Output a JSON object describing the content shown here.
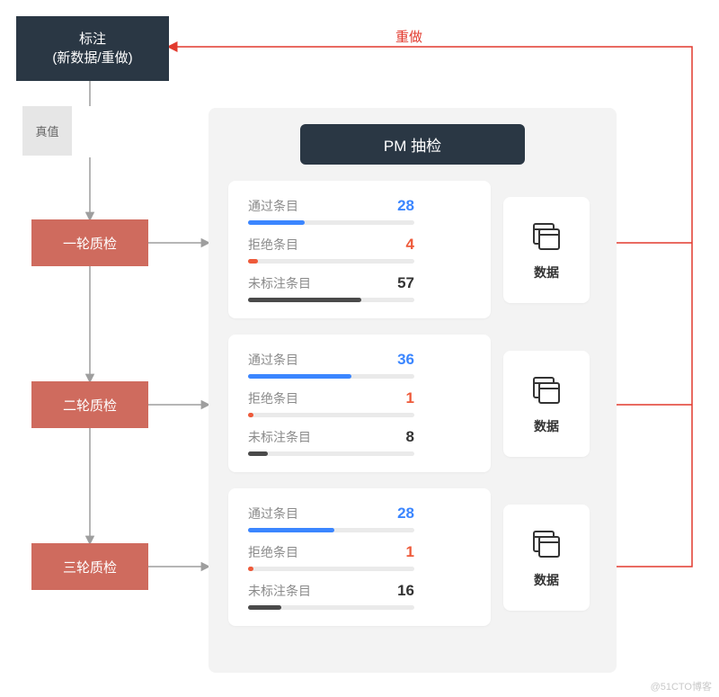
{
  "annotate": {
    "line1": "标注",
    "line2": "(新数据/重做)"
  },
  "truth_label": "真值",
  "rounds": [
    "一轮质检",
    "二轮质检",
    "三轮质检"
  ],
  "panel_title": "PM 抽检",
  "metric_labels": {
    "pass": "通过条目",
    "reject": "拒绝条目",
    "unlabeled": "未标注条目"
  },
  "cards": [
    {
      "pass": 28,
      "reject": 4,
      "unlabeled": 57,
      "pass_w": 34,
      "reject_w": 6,
      "unlabeled_w": 68
    },
    {
      "pass": 36,
      "reject": 1,
      "unlabeled": 8,
      "pass_w": 62,
      "reject_w": 3,
      "unlabeled_w": 12
    },
    {
      "pass": 28,
      "reject": 1,
      "unlabeled": 16,
      "pass_w": 52,
      "reject_w": 3,
      "unlabeled_w": 20
    }
  ],
  "data_label": "数据",
  "redo_label": "重做",
  "watermark": "@51CTO博客"
}
